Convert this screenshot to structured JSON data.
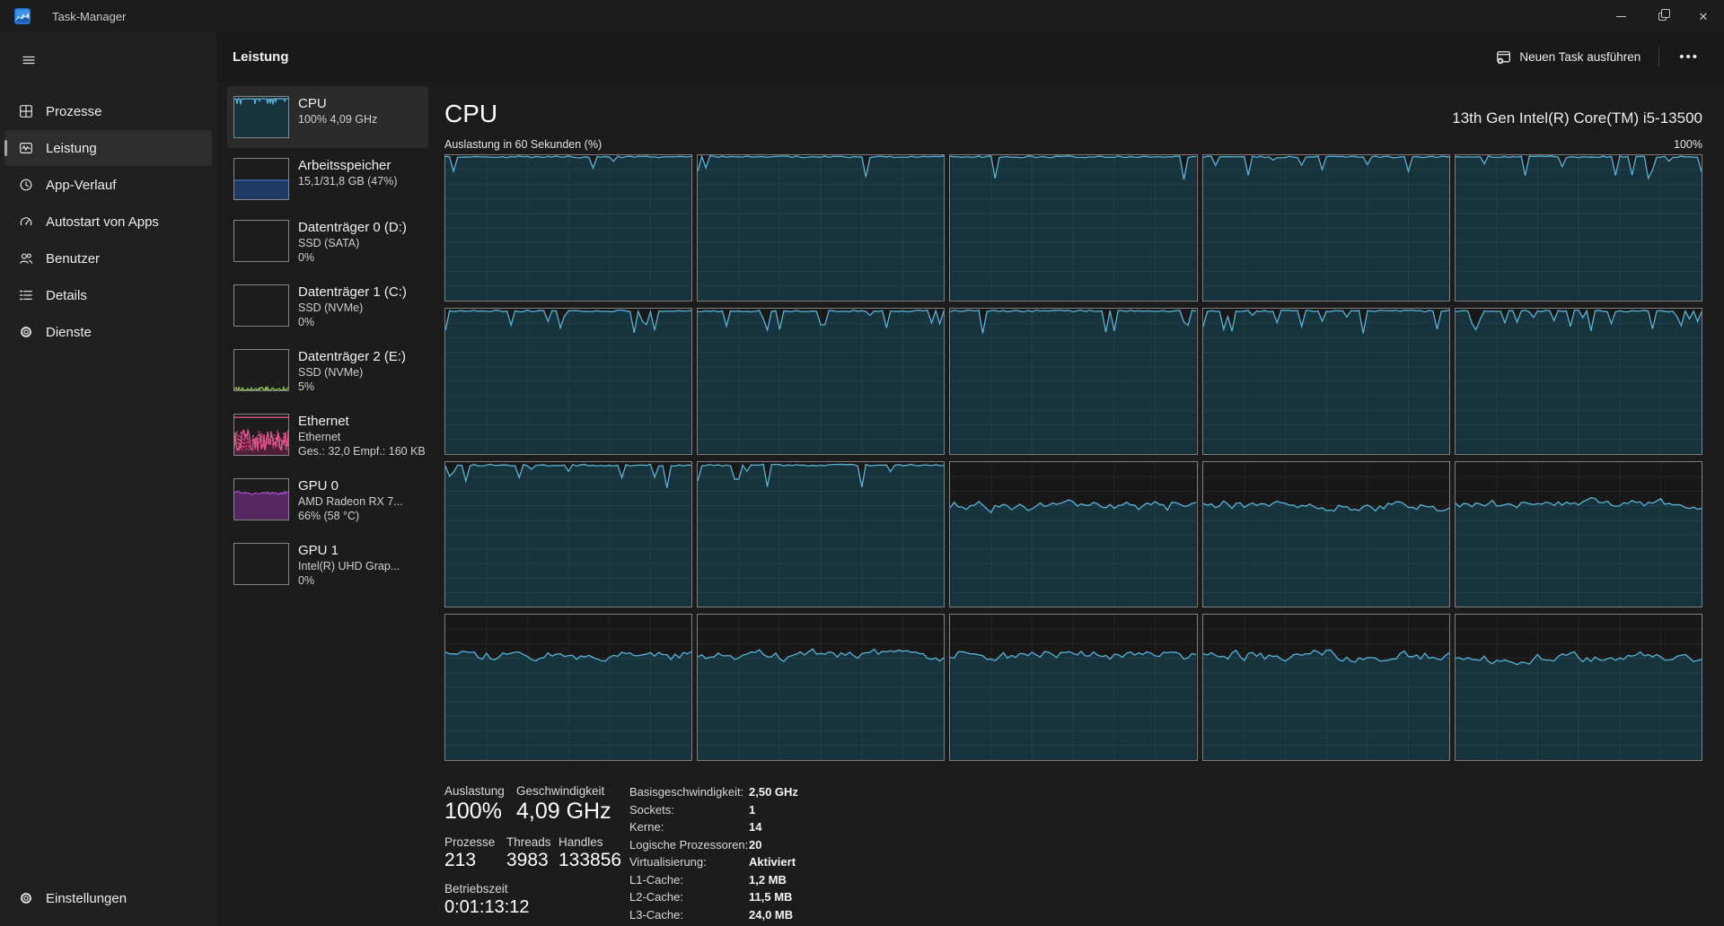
{
  "colors": {
    "cpu_line": "#58b5d9",
    "cpu_fill": "#17333e",
    "grid_line": "rgba(255,255,255,0.06)",
    "mem_line": "#4272b8",
    "mem_fill": "#1f3a64",
    "disk_line": "#8bc34a",
    "eth_line": "#e0538c",
    "eth_fill": "#4f1f38",
    "gpu_line": "#a64ac9",
    "gpu_fill": "#55275f"
  },
  "titlebar": {
    "title": "Task-Manager"
  },
  "header": {
    "page_title": "Leistung",
    "run_task_label": "Neuen Task ausführen",
    "more_label": "•••"
  },
  "sidebar": {
    "items": [
      {
        "label": "Prozesse",
        "icon": "processes-icon",
        "selected": false
      },
      {
        "label": "Leistung",
        "icon": "performance-icon",
        "selected": true
      },
      {
        "label": "App-Verlauf",
        "icon": "app-history-icon",
        "selected": false
      },
      {
        "label": "Autostart von Apps",
        "icon": "startup-icon",
        "selected": false
      },
      {
        "label": "Benutzer",
        "icon": "users-icon",
        "selected": false
      },
      {
        "label": "Details",
        "icon": "details-icon",
        "selected": false
      },
      {
        "label": "Dienste",
        "icon": "services-icon",
        "selected": false
      }
    ],
    "settings_label": "Einstellungen"
  },
  "perf_list": [
    {
      "id": "cpu",
      "title": "CPU",
      "lines": [
        "100%  4,09 GHz"
      ],
      "selected": true,
      "graph": {
        "type": "p",
        "level": 0.96,
        "dip": 0.18,
        "seed": 11,
        "line": "cpu_line",
        "fill": "cpu_fill"
      }
    },
    {
      "id": "memory",
      "title": "Arbeitsspeicher",
      "lines": [
        "15,1/31,8 GB (47%)"
      ],
      "selected": false,
      "graph": {
        "type": "flat",
        "level": 0.47,
        "line": "mem_line",
        "fill": "mem_fill"
      }
    },
    {
      "id": "disk0",
      "title": "Datenträger 0 (D:)",
      "lines": [
        "SSD (SATA)",
        "0%"
      ],
      "selected": false,
      "graph": {
        "type": "empty"
      }
    },
    {
      "id": "disk1",
      "title": "Datenträger 1 (C:)",
      "lines": [
        "SSD (NVMe)",
        "0%"
      ],
      "selected": false,
      "graph": {
        "type": "empty"
      }
    },
    {
      "id": "disk2",
      "title": "Datenträger 2 (E:)",
      "lines": [
        "SSD (NVMe)",
        "5%"
      ],
      "selected": false,
      "graph": {
        "type": "spikes",
        "seed": 7,
        "line": "disk_line"
      }
    },
    {
      "id": "ethernet",
      "title": "Ethernet",
      "lines": [
        "Ethernet",
        "Ges.: 32,0 Empf.: 160 KB"
      ],
      "selected": false,
      "graph": {
        "type": "net",
        "seed": 5,
        "line": "eth_line",
        "fill": "eth_fill"
      }
    },
    {
      "id": "gpu0",
      "title": "GPU 0",
      "lines": [
        "AMD Radeon RX 7...",
        "66%  (58 °C)"
      ],
      "selected": false,
      "graph": {
        "type": "e",
        "level": 0.66,
        "seed": 9,
        "line": "gpu_line",
        "fill": "gpu_fill"
      }
    },
    {
      "id": "gpu1",
      "title": "GPU 1",
      "lines": [
        "Intel(R) UHD Grap...",
        "0%"
      ],
      "selected": false,
      "graph": {
        "type": "empty"
      }
    }
  ],
  "cpu": {
    "title": "CPU",
    "subtitle": "13th Gen Intel(R) Core(TM) i5-13500",
    "graph_label": "Auslastung in 60 Sekunden (%)",
    "graph_max": "100%",
    "cores": [
      {
        "style": "p",
        "level": 0.995,
        "dip": 0.05,
        "seed": 3
      },
      {
        "style": "p",
        "level": 0.995,
        "dip": 0.06,
        "seed": 7
      },
      {
        "style": "p",
        "level": 0.995,
        "dip": 0.06,
        "seed": 12
      },
      {
        "style": "p",
        "level": 0.995,
        "dip": 0.07,
        "seed": 19
      },
      {
        "style": "p",
        "level": 0.995,
        "dip": 0.08,
        "seed": 25
      },
      {
        "style": "p",
        "level": 0.99,
        "dip": 0.12,
        "seed": 31
      },
      {
        "style": "p",
        "level": 0.99,
        "dip": 0.13,
        "seed": 38
      },
      {
        "style": "p",
        "level": 0.99,
        "dip": 0.11,
        "seed": 44
      },
      {
        "style": "p",
        "level": 0.99,
        "dip": 0.13,
        "seed": 52
      },
      {
        "style": "p",
        "level": 0.99,
        "dip": 0.14,
        "seed": 57
      },
      {
        "style": "p",
        "level": 0.985,
        "dip": 0.17,
        "seed": 63
      },
      {
        "style": "p",
        "level": 0.985,
        "dip": 0.19,
        "seed": 68
      },
      {
        "style": "e",
        "level": 0.7,
        "seed": 74
      },
      {
        "style": "e",
        "level": 0.7,
        "seed": 79
      },
      {
        "style": "e",
        "level": 0.71,
        "seed": 85
      },
      {
        "style": "e",
        "level": 0.72,
        "seed": 91
      },
      {
        "style": "e",
        "level": 0.72,
        "seed": 96
      },
      {
        "style": "e",
        "level": 0.71,
        "seed": 104
      },
      {
        "style": "e",
        "level": 0.72,
        "seed": 109
      },
      {
        "style": "e",
        "level": 0.71,
        "seed": 113
      }
    ]
  },
  "stats": {
    "primary": [
      {
        "label": "Auslastung",
        "value": "100%"
      },
      {
        "label": "Geschwindigkeit",
        "value": "4,09 GHz"
      }
    ],
    "secondary": [
      {
        "label": "Prozesse",
        "value": "213"
      },
      {
        "label": "Threads",
        "value": "3983"
      },
      {
        "label": "Handles",
        "value": "133856"
      }
    ],
    "uptime": {
      "label": "Betriebszeit",
      "value": "0:01:13:12"
    },
    "details": [
      {
        "label": "Basisgeschwindigkeit:",
        "value": "2,50 GHz"
      },
      {
        "label": "Sockets:",
        "value": "1"
      },
      {
        "label": "Kerne:",
        "value": "14"
      },
      {
        "label": "Logische Prozessoren:",
        "value": "20"
      },
      {
        "label": "Virtualisierung:",
        "value": "Aktiviert"
      },
      {
        "label": "L1-Cache:",
        "value": "1,2 MB"
      },
      {
        "label": "L2-Cache:",
        "value": "11,5 MB"
      },
      {
        "label": "L3-Cache:",
        "value": "24,0 MB"
      }
    ]
  }
}
